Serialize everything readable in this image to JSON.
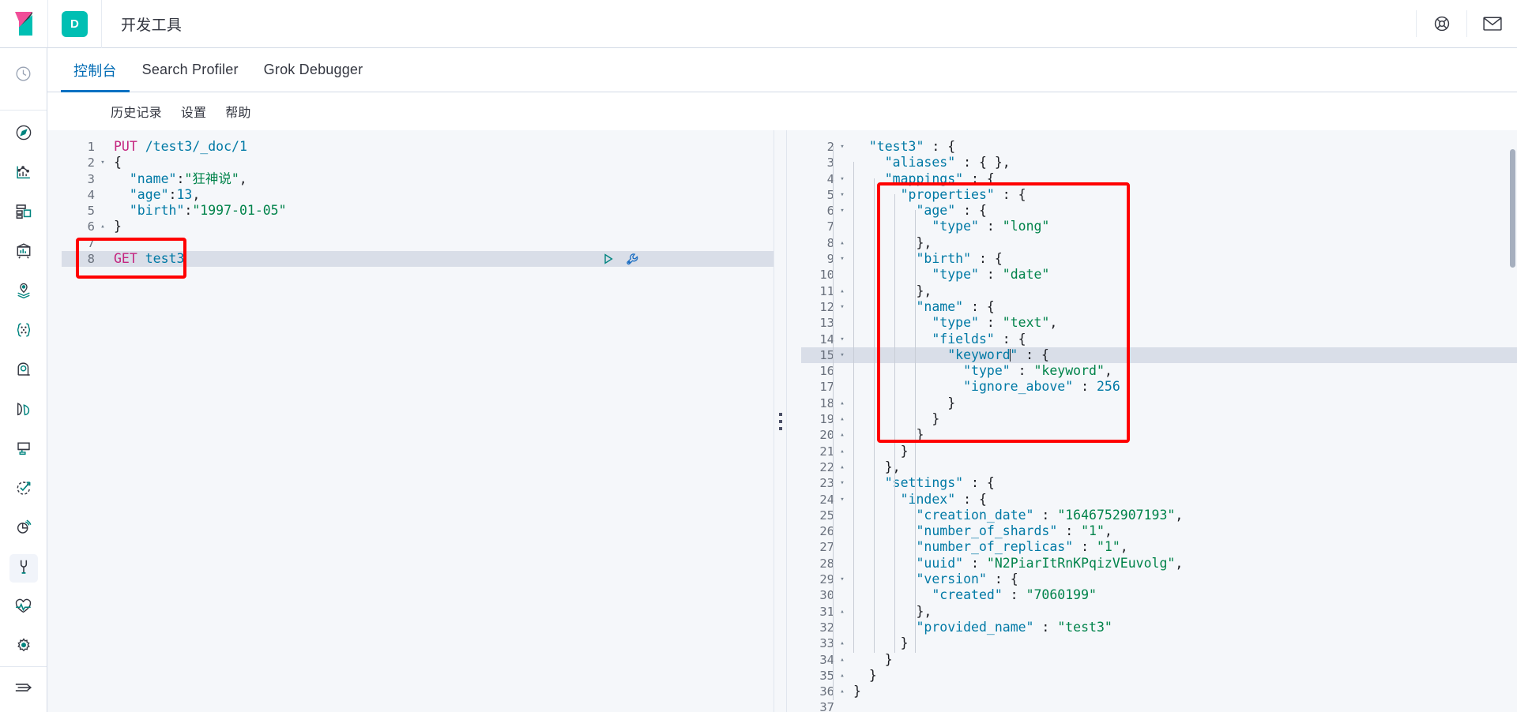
{
  "header": {
    "title": "开发工具",
    "space_badge": "D",
    "logo_name": "kibana-logo",
    "help_icon": "life-ring-icon",
    "newsfeed_icon": "mail-icon"
  },
  "rail": {
    "recent_icon": "clock-icon",
    "items": [
      {
        "icon": "compass-icon",
        "name": "discover"
      },
      {
        "icon": "bar-chart-icon",
        "name": "visualize"
      },
      {
        "icon": "dashboard-grid-icon",
        "name": "dashboard"
      },
      {
        "icon": "canvas-easel-icon",
        "name": "canvas"
      },
      {
        "icon": "map-marker-layers-icon",
        "name": "maps"
      },
      {
        "icon": "machine-learning-icon",
        "name": "machine-learning"
      },
      {
        "icon": "logs-user-icon",
        "name": "logs"
      },
      {
        "icon": "metrics-icon",
        "name": "metrics"
      },
      {
        "icon": "apm-icon",
        "name": "apm"
      },
      {
        "icon": "uptime-check-icon",
        "name": "uptime"
      },
      {
        "icon": "siem-icon",
        "name": "security"
      },
      {
        "icon": "wrench-icon",
        "name": "dev-tools",
        "active": true
      },
      {
        "icon": "heartbeat-icon",
        "name": "stack-monitoring"
      },
      {
        "icon": "gear-icon",
        "name": "stack-management"
      }
    ],
    "collapse_icon": "arrow-collapse-icon"
  },
  "tabs": [
    {
      "label": "控制台",
      "active": true
    },
    {
      "label": "Search Profiler",
      "active": false
    },
    {
      "label": "Grok Debugger",
      "active": false
    }
  ],
  "subnav": [
    {
      "label": "历史记录"
    },
    {
      "label": "设置"
    },
    {
      "label": "帮助"
    }
  ],
  "request_editor": {
    "play_icon": "play-triangle-icon",
    "wrench_icon": "wrench-tool-icon",
    "lines": [
      {
        "n": "1",
        "fold": "",
        "tokens": [
          {
            "t": "method",
            "v": "PUT"
          },
          {
            "t": "plain",
            "v": " "
          },
          {
            "t": "url",
            "v": "/test3/_doc/1"
          }
        ]
      },
      {
        "n": "2",
        "fold": "▾",
        "tokens": [
          {
            "t": "punc",
            "v": "{"
          }
        ]
      },
      {
        "n": "3",
        "fold": "",
        "tokens": [
          {
            "t": "key",
            "v": "  \"name\""
          },
          {
            "t": "punc",
            "v": ":"
          },
          {
            "t": "str",
            "v": "\"狂神说\""
          },
          {
            "t": "punc",
            "v": ","
          }
        ]
      },
      {
        "n": "4",
        "fold": "",
        "tokens": [
          {
            "t": "key",
            "v": "  \"age\""
          },
          {
            "t": "punc",
            "v": ":"
          },
          {
            "t": "num",
            "v": "13"
          },
          {
            "t": "punc",
            "v": ","
          }
        ]
      },
      {
        "n": "5",
        "fold": "",
        "tokens": [
          {
            "t": "key",
            "v": "  \"birth\""
          },
          {
            "t": "punc",
            "v": ":"
          },
          {
            "t": "str",
            "v": "\"1997-01-05\""
          }
        ]
      },
      {
        "n": "6",
        "fold": "▴",
        "tokens": [
          {
            "t": "punc",
            "v": "}"
          }
        ]
      },
      {
        "n": "7",
        "fold": "",
        "tokens": []
      },
      {
        "n": "8",
        "fold": "",
        "highlight": true,
        "caret_after": true,
        "tokens": [
          {
            "t": "method",
            "v": "GET"
          },
          {
            "t": "plain",
            "v": " "
          },
          {
            "t": "url",
            "v": "test3"
          }
        ]
      }
    ]
  },
  "response_editor": {
    "lines": [
      {
        "n": "2",
        "fold": "▾",
        "indent": 1,
        "tokens": [
          {
            "t": "key",
            "v": "\"test3\""
          },
          {
            "t": "punc",
            "v": " : {"
          }
        ]
      },
      {
        "n": "3",
        "fold": "",
        "indent": 2,
        "tokens": [
          {
            "t": "key",
            "v": "\"aliases\""
          },
          {
            "t": "punc",
            "v": " : { },"
          }
        ]
      },
      {
        "n": "4",
        "fold": "▾",
        "indent": 2,
        "tokens": [
          {
            "t": "key",
            "v": "\"mappings\""
          },
          {
            "t": "punc",
            "v": " : {"
          }
        ]
      },
      {
        "n": "5",
        "fold": "▾",
        "indent": 3,
        "tokens": [
          {
            "t": "key",
            "v": "\"properties\""
          },
          {
            "t": "punc",
            "v": " : {"
          }
        ]
      },
      {
        "n": "6",
        "fold": "▾",
        "indent": 4,
        "tokens": [
          {
            "t": "key",
            "v": "\"age\""
          },
          {
            "t": "punc",
            "v": " : {"
          }
        ]
      },
      {
        "n": "7",
        "fold": "",
        "indent": 5,
        "tokens": [
          {
            "t": "key",
            "v": "\"type\""
          },
          {
            "t": "punc",
            "v": " : "
          },
          {
            "t": "str",
            "v": "\"long\""
          }
        ]
      },
      {
        "n": "8",
        "fold": "▴",
        "indent": 4,
        "tokens": [
          {
            "t": "punc",
            "v": "},"
          }
        ]
      },
      {
        "n": "9",
        "fold": "▾",
        "indent": 4,
        "tokens": [
          {
            "t": "key",
            "v": "\"birth\""
          },
          {
            "t": "punc",
            "v": " : {"
          }
        ]
      },
      {
        "n": "10",
        "fold": "",
        "indent": 5,
        "tokens": [
          {
            "t": "key",
            "v": "\"type\""
          },
          {
            "t": "punc",
            "v": " : "
          },
          {
            "t": "str",
            "v": "\"date\""
          }
        ]
      },
      {
        "n": "11",
        "fold": "▴",
        "indent": 4,
        "tokens": [
          {
            "t": "punc",
            "v": "},"
          }
        ]
      },
      {
        "n": "12",
        "fold": "▾",
        "indent": 4,
        "tokens": [
          {
            "t": "key",
            "v": "\"name\""
          },
          {
            "t": "punc",
            "v": " : {"
          }
        ]
      },
      {
        "n": "13",
        "fold": "",
        "indent": 5,
        "tokens": [
          {
            "t": "key",
            "v": "\"type\""
          },
          {
            "t": "punc",
            "v": " : "
          },
          {
            "t": "str",
            "v": "\"text\""
          },
          {
            "t": "punc",
            "v": ","
          }
        ]
      },
      {
        "n": "14",
        "fold": "▾",
        "indent": 5,
        "tokens": [
          {
            "t": "key",
            "v": "\"fields\""
          },
          {
            "t": "punc",
            "v": " : {"
          }
        ]
      },
      {
        "n": "15",
        "fold": "▾",
        "indent": 6,
        "highlight": true,
        "caret_at": 1,
        "tokens": [
          {
            "t": "key",
            "v": "\"keyword\""
          },
          {
            "t": "punc",
            "v": " : {"
          }
        ]
      },
      {
        "n": "16",
        "fold": "",
        "indent": 7,
        "tokens": [
          {
            "t": "key",
            "v": "\"type\""
          },
          {
            "t": "punc",
            "v": " : "
          },
          {
            "t": "str",
            "v": "\"keyword\""
          },
          {
            "t": "punc",
            "v": ","
          }
        ]
      },
      {
        "n": "17",
        "fold": "",
        "indent": 7,
        "tokens": [
          {
            "t": "key",
            "v": "\"ignore_above\""
          },
          {
            "t": "punc",
            "v": " : "
          },
          {
            "t": "num",
            "v": "256"
          }
        ]
      },
      {
        "n": "18",
        "fold": "▴",
        "indent": 6,
        "tokens": [
          {
            "t": "punc",
            "v": "}"
          }
        ]
      },
      {
        "n": "19",
        "fold": "▴",
        "indent": 5,
        "tokens": [
          {
            "t": "punc",
            "v": "}"
          }
        ]
      },
      {
        "n": "20",
        "fold": "▴",
        "indent": 4,
        "tokens": [
          {
            "t": "punc",
            "v": "}"
          }
        ]
      },
      {
        "n": "21",
        "fold": "▴",
        "indent": 3,
        "tokens": [
          {
            "t": "punc",
            "v": "}"
          }
        ]
      },
      {
        "n": "22",
        "fold": "▴",
        "indent": 2,
        "tokens": [
          {
            "t": "punc",
            "v": "},"
          }
        ]
      },
      {
        "n": "23",
        "fold": "▾",
        "indent": 2,
        "tokens": [
          {
            "t": "key",
            "v": "\"settings\""
          },
          {
            "t": "punc",
            "v": " : {"
          }
        ]
      },
      {
        "n": "24",
        "fold": "▾",
        "indent": 3,
        "tokens": [
          {
            "t": "key",
            "v": "\"index\""
          },
          {
            "t": "punc",
            "v": " : {"
          }
        ]
      },
      {
        "n": "25",
        "fold": "",
        "indent": 4,
        "tokens": [
          {
            "t": "key",
            "v": "\"creation_date\""
          },
          {
            "t": "punc",
            "v": " : "
          },
          {
            "t": "str",
            "v": "\"1646752907193\""
          },
          {
            "t": "punc",
            "v": ","
          }
        ]
      },
      {
        "n": "26",
        "fold": "",
        "indent": 4,
        "tokens": [
          {
            "t": "key",
            "v": "\"number_of_shards\""
          },
          {
            "t": "punc",
            "v": " : "
          },
          {
            "t": "str",
            "v": "\"1\""
          },
          {
            "t": "punc",
            "v": ","
          }
        ]
      },
      {
        "n": "27",
        "fold": "",
        "indent": 4,
        "tokens": [
          {
            "t": "key",
            "v": "\"number_of_replicas\""
          },
          {
            "t": "punc",
            "v": " : "
          },
          {
            "t": "str",
            "v": "\"1\""
          },
          {
            "t": "punc",
            "v": ","
          }
        ]
      },
      {
        "n": "28",
        "fold": "",
        "indent": 4,
        "tokens": [
          {
            "t": "key",
            "v": "\"uuid\""
          },
          {
            "t": "punc",
            "v": " : "
          },
          {
            "t": "str",
            "v": "\"N2PiarItRnKPqizVEuvolg\""
          },
          {
            "t": "punc",
            "v": ","
          }
        ]
      },
      {
        "n": "29",
        "fold": "▾",
        "indent": 4,
        "tokens": [
          {
            "t": "key",
            "v": "\"version\""
          },
          {
            "t": "punc",
            "v": " : {"
          }
        ]
      },
      {
        "n": "30",
        "fold": "",
        "indent": 5,
        "tokens": [
          {
            "t": "key",
            "v": "\"created\""
          },
          {
            "t": "punc",
            "v": " : "
          },
          {
            "t": "str",
            "v": "\"7060199\""
          }
        ]
      },
      {
        "n": "31",
        "fold": "▴",
        "indent": 4,
        "tokens": [
          {
            "t": "punc",
            "v": "},"
          }
        ]
      },
      {
        "n": "32",
        "fold": "",
        "indent": 4,
        "tokens": [
          {
            "t": "key",
            "v": "\"provided_name\""
          },
          {
            "t": "punc",
            "v": " : "
          },
          {
            "t": "str",
            "v": "\"test3\""
          }
        ]
      },
      {
        "n": "33",
        "fold": "▴",
        "indent": 3,
        "tokens": [
          {
            "t": "punc",
            "v": "}"
          }
        ]
      },
      {
        "n": "34",
        "fold": "▴",
        "indent": 2,
        "tokens": [
          {
            "t": "punc",
            "v": "}"
          }
        ]
      },
      {
        "n": "35",
        "fold": "▴",
        "indent": 1,
        "tokens": [
          {
            "t": "punc",
            "v": "}"
          }
        ]
      },
      {
        "n": "36",
        "fold": "▴",
        "indent": 0,
        "tokens": [
          {
            "t": "punc",
            "v": "}"
          }
        ]
      },
      {
        "n": "37",
        "fold": "",
        "indent": 0,
        "tokens": []
      }
    ]
  },
  "annotations": {
    "color": "#ff0000",
    "request_box": {
      "label": "get-test3-highlight"
    },
    "response_box": {
      "label": "mappings-properties-highlight"
    }
  }
}
